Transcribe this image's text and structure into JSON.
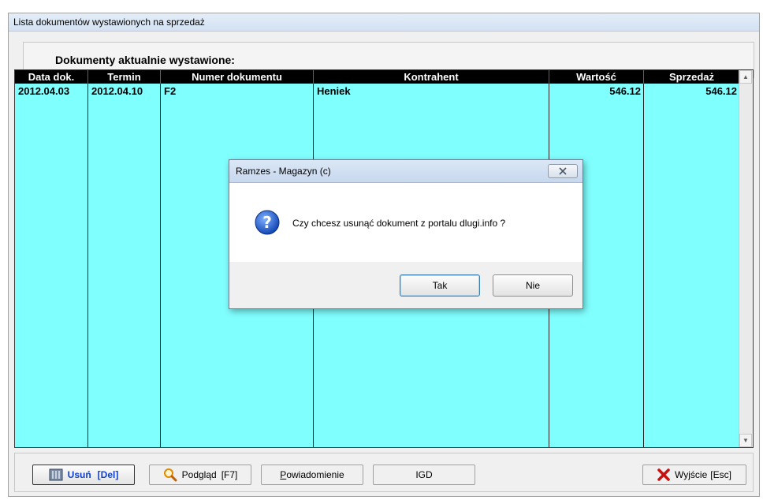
{
  "window": {
    "title": "Lista dokumentów wystawionych na sprzedaż"
  },
  "header": {
    "label": "Dokumenty aktualnie wystawione:"
  },
  "table": {
    "columns": [
      "Data dok.",
      "Termin",
      "Numer dokumentu",
      "Kontrahent",
      "Wartość",
      "Sprzedaż"
    ],
    "rows": [
      [
        "2012.04.03",
        "2012.04.10",
        "F2",
        "Heniek",
        "546.12",
        "546.12"
      ]
    ]
  },
  "toolbar": {
    "delete_label": "Usuń",
    "delete_key": "[Del]",
    "preview_label": "Podgląd",
    "preview_key": "[F7]",
    "notify_label_first": "P",
    "notify_label_rest": "owiadomienie",
    "igd_label": "IGD",
    "exit_label": "Wyjście",
    "exit_key": "[Esc]"
  },
  "dialog": {
    "title": "Ramzes - Magazyn (c)",
    "message": "Czy chcesz usunąć dokument z portalu dlugi.info ?",
    "yes_label": "Tak",
    "no_label": "Nie"
  },
  "colors": {
    "grid_background": "#80ffff",
    "header_background": "#000000",
    "delete_text": "#1040d0"
  },
  "icons": {
    "delete": "trash-icon",
    "preview": "magnifier-icon",
    "exit": "red-x-icon",
    "dialog": "question-icon",
    "close": "close-icon"
  }
}
